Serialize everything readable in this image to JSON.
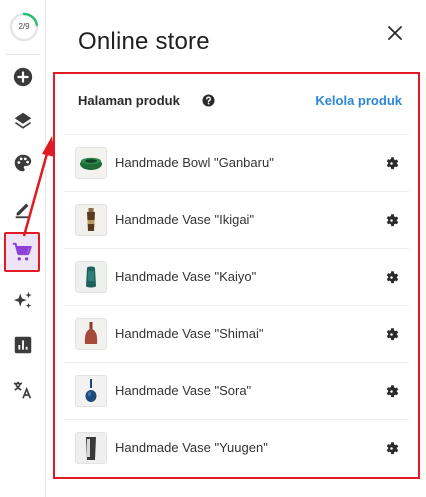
{
  "rail": {
    "progress": {
      "text": "2/9",
      "completed": 2,
      "total": 9,
      "color": "#2fbf71"
    },
    "items": [
      {
        "name": "add-icon"
      },
      {
        "name": "layers-icon"
      },
      {
        "name": "palette-icon"
      },
      {
        "name": "edit-icon"
      },
      {
        "name": "cart-icon",
        "active": true
      },
      {
        "name": "sparkle-icon"
      },
      {
        "name": "chart-icon"
      },
      {
        "name": "translate-icon"
      }
    ]
  },
  "panel": {
    "title": "Online store",
    "close_icon": "close-icon"
  },
  "section": {
    "title": "Halaman produk",
    "help_icon": "help-icon",
    "manage_link": "Kelola produk"
  },
  "products": [
    {
      "name": "Handmade Bowl \"Ganbaru\""
    },
    {
      "name": "Handmade Vase \"Ikigai\""
    },
    {
      "name": "Handmade Vase \"Kaiyo\""
    },
    {
      "name": "Handmade Vase \"Shimai\""
    },
    {
      "name": "Handmade Vase \"Sora\""
    },
    {
      "name": "Handmade Vase \"Yuugen\""
    }
  ],
  "colors": {
    "accent_link": "#2d86d9",
    "highlight": "#e01b24",
    "active_icon": "#8e3fd6"
  }
}
